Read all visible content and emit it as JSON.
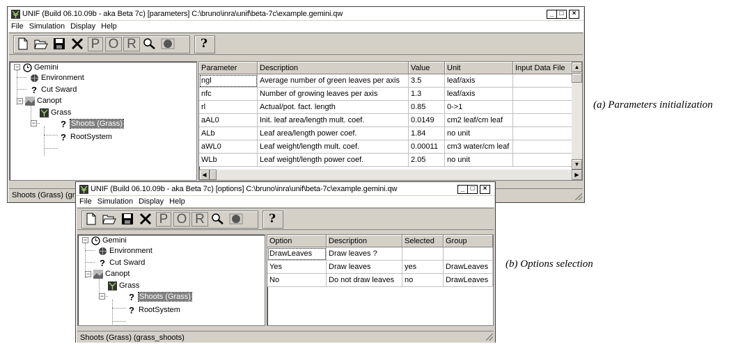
{
  "window1": {
    "title": "UNIF (Build 06.10.09b - aka Beta 7c)  [parameters] C:\\bruno\\inra\\unif\\beta-7c\\example.gemini.qw",
    "menu": [
      "File",
      "Simulation",
      "Display",
      "Help"
    ],
    "toolbar_letters": [
      "P",
      "O",
      "R"
    ],
    "help_glyph": "?",
    "tree": {
      "root": "Gemini",
      "environment": "Environment",
      "cut_sward": "Cut Sward",
      "canopt": "Canopt",
      "grass": "Grass",
      "shoots": "Shoots (Grass)",
      "root_system": "RootSystem"
    },
    "table": {
      "headers": [
        "Parameter",
        "Description",
        "Value",
        "Unit",
        "Input Data File"
      ],
      "rows": [
        [
          "ngl",
          "Average number of green leaves per axis",
          "3.5",
          "leaf/axis",
          ""
        ],
        [
          "nfc",
          "Number of growing leaves per axis",
          "1.3",
          "leaf/axis",
          ""
        ],
        [
          "rl",
          "Actual/pot. fact. length",
          "0.85",
          "0->1",
          ""
        ],
        [
          "aAL0",
          "Init. leaf area/length mult. coef.",
          "0.0149",
          "cm2 leaf/cm leaf",
          ""
        ],
        [
          "ALb",
          "Leaf area/length power coef.",
          "1.84",
          "no unit",
          ""
        ],
        [
          "aWL0",
          "Leaf weight/length mult. coef.",
          "0.00011",
          "cm3 water/cm leaf",
          ""
        ],
        [
          "WLb",
          "Leaf weight/length power coef.",
          "2.05",
          "no unit",
          ""
        ]
      ]
    },
    "status": "Shoots (Grass) (gr"
  },
  "window2": {
    "title": "UNIF (Build 06.10.09b - aka Beta 7c)  [options] C:\\bruno\\inra\\unif\\beta-7c\\example.gemini.qw",
    "menu": [
      "File",
      "Simulation",
      "Display",
      "Help"
    ],
    "toolbar_letters": [
      "P",
      "O",
      "R"
    ],
    "help_glyph": "?",
    "tree": {
      "root": "Gemini",
      "environment": "Environment",
      "cut_sward": "Cut Sward",
      "canopt": "Canopt",
      "grass": "Grass",
      "shoots": "Shoots (Grass)",
      "root_system": "RootSystem"
    },
    "table": {
      "headers": [
        "Option",
        "Description",
        "Selected",
        "Group"
      ],
      "rows": [
        [
          "DrawLeaves",
          "Draw leaves ?",
          "",
          ""
        ],
        [
          "Yes",
          "Draw leaves",
          "yes",
          "DrawLeaves"
        ],
        [
          "No",
          "Do not draw leaves",
          "no",
          "DrawLeaves"
        ]
      ]
    },
    "status": "Shoots (Grass) (grass_shoots)"
  },
  "captions": {
    "a": "(a) Parameters initialization",
    "b": "(b) Options selection"
  },
  "colors": {
    "face": "#d4d0c8",
    "shadow": "#808080",
    "selection": "#808080"
  }
}
